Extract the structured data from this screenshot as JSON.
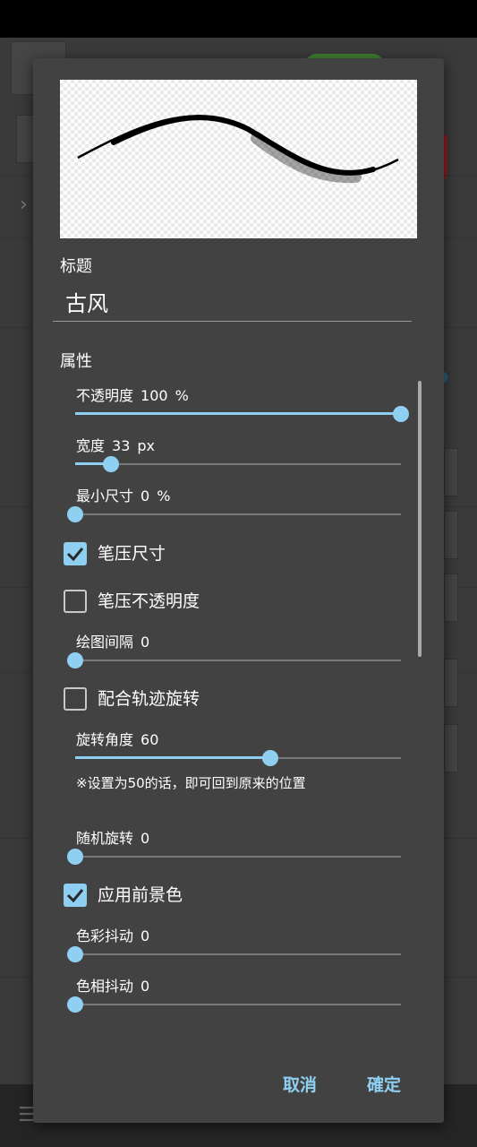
{
  "dialog": {
    "title_section_label": "标题",
    "title_value": "古风",
    "properties_label": "属性",
    "sliders": [
      {
        "label": "不透明度",
        "value": "100",
        "unit": "%",
        "fraction": 1.0
      },
      {
        "label": "宽度",
        "value": "33",
        "unit": "px",
        "fraction": 0.11
      },
      {
        "label": "最小尺寸",
        "value": "0",
        "unit": "%",
        "fraction": 0.0
      },
      {
        "label": "绘图间隔",
        "value": "0",
        "unit": "",
        "fraction": 0.0
      },
      {
        "label": "旋转角度",
        "value": "60",
        "unit": "",
        "fraction": 0.6
      },
      {
        "label": "随机旋转",
        "value": "0",
        "unit": "",
        "fraction": 0.0
      },
      {
        "label": "色彩抖动",
        "value": "0",
        "unit": "",
        "fraction": 0.0
      },
      {
        "label": "色相抖动",
        "value": "0",
        "unit": "",
        "fraction": 0.0
      }
    ],
    "checkboxes": [
      {
        "label": "笔压尺寸",
        "checked": true
      },
      {
        "label": "笔压不透明度",
        "checked": false
      },
      {
        "label": "配合轨迹旋转",
        "checked": false
      },
      {
        "label": "应用前景色",
        "checked": true
      }
    ],
    "rotation_note": "※设置为50的话，即可回到原来的位置",
    "cancel_label": "取消",
    "ok_label": "確定"
  },
  "colors": {
    "dialog_bg": "#424242",
    "accent": "#8fd0f2",
    "text": "#ffffff"
  }
}
